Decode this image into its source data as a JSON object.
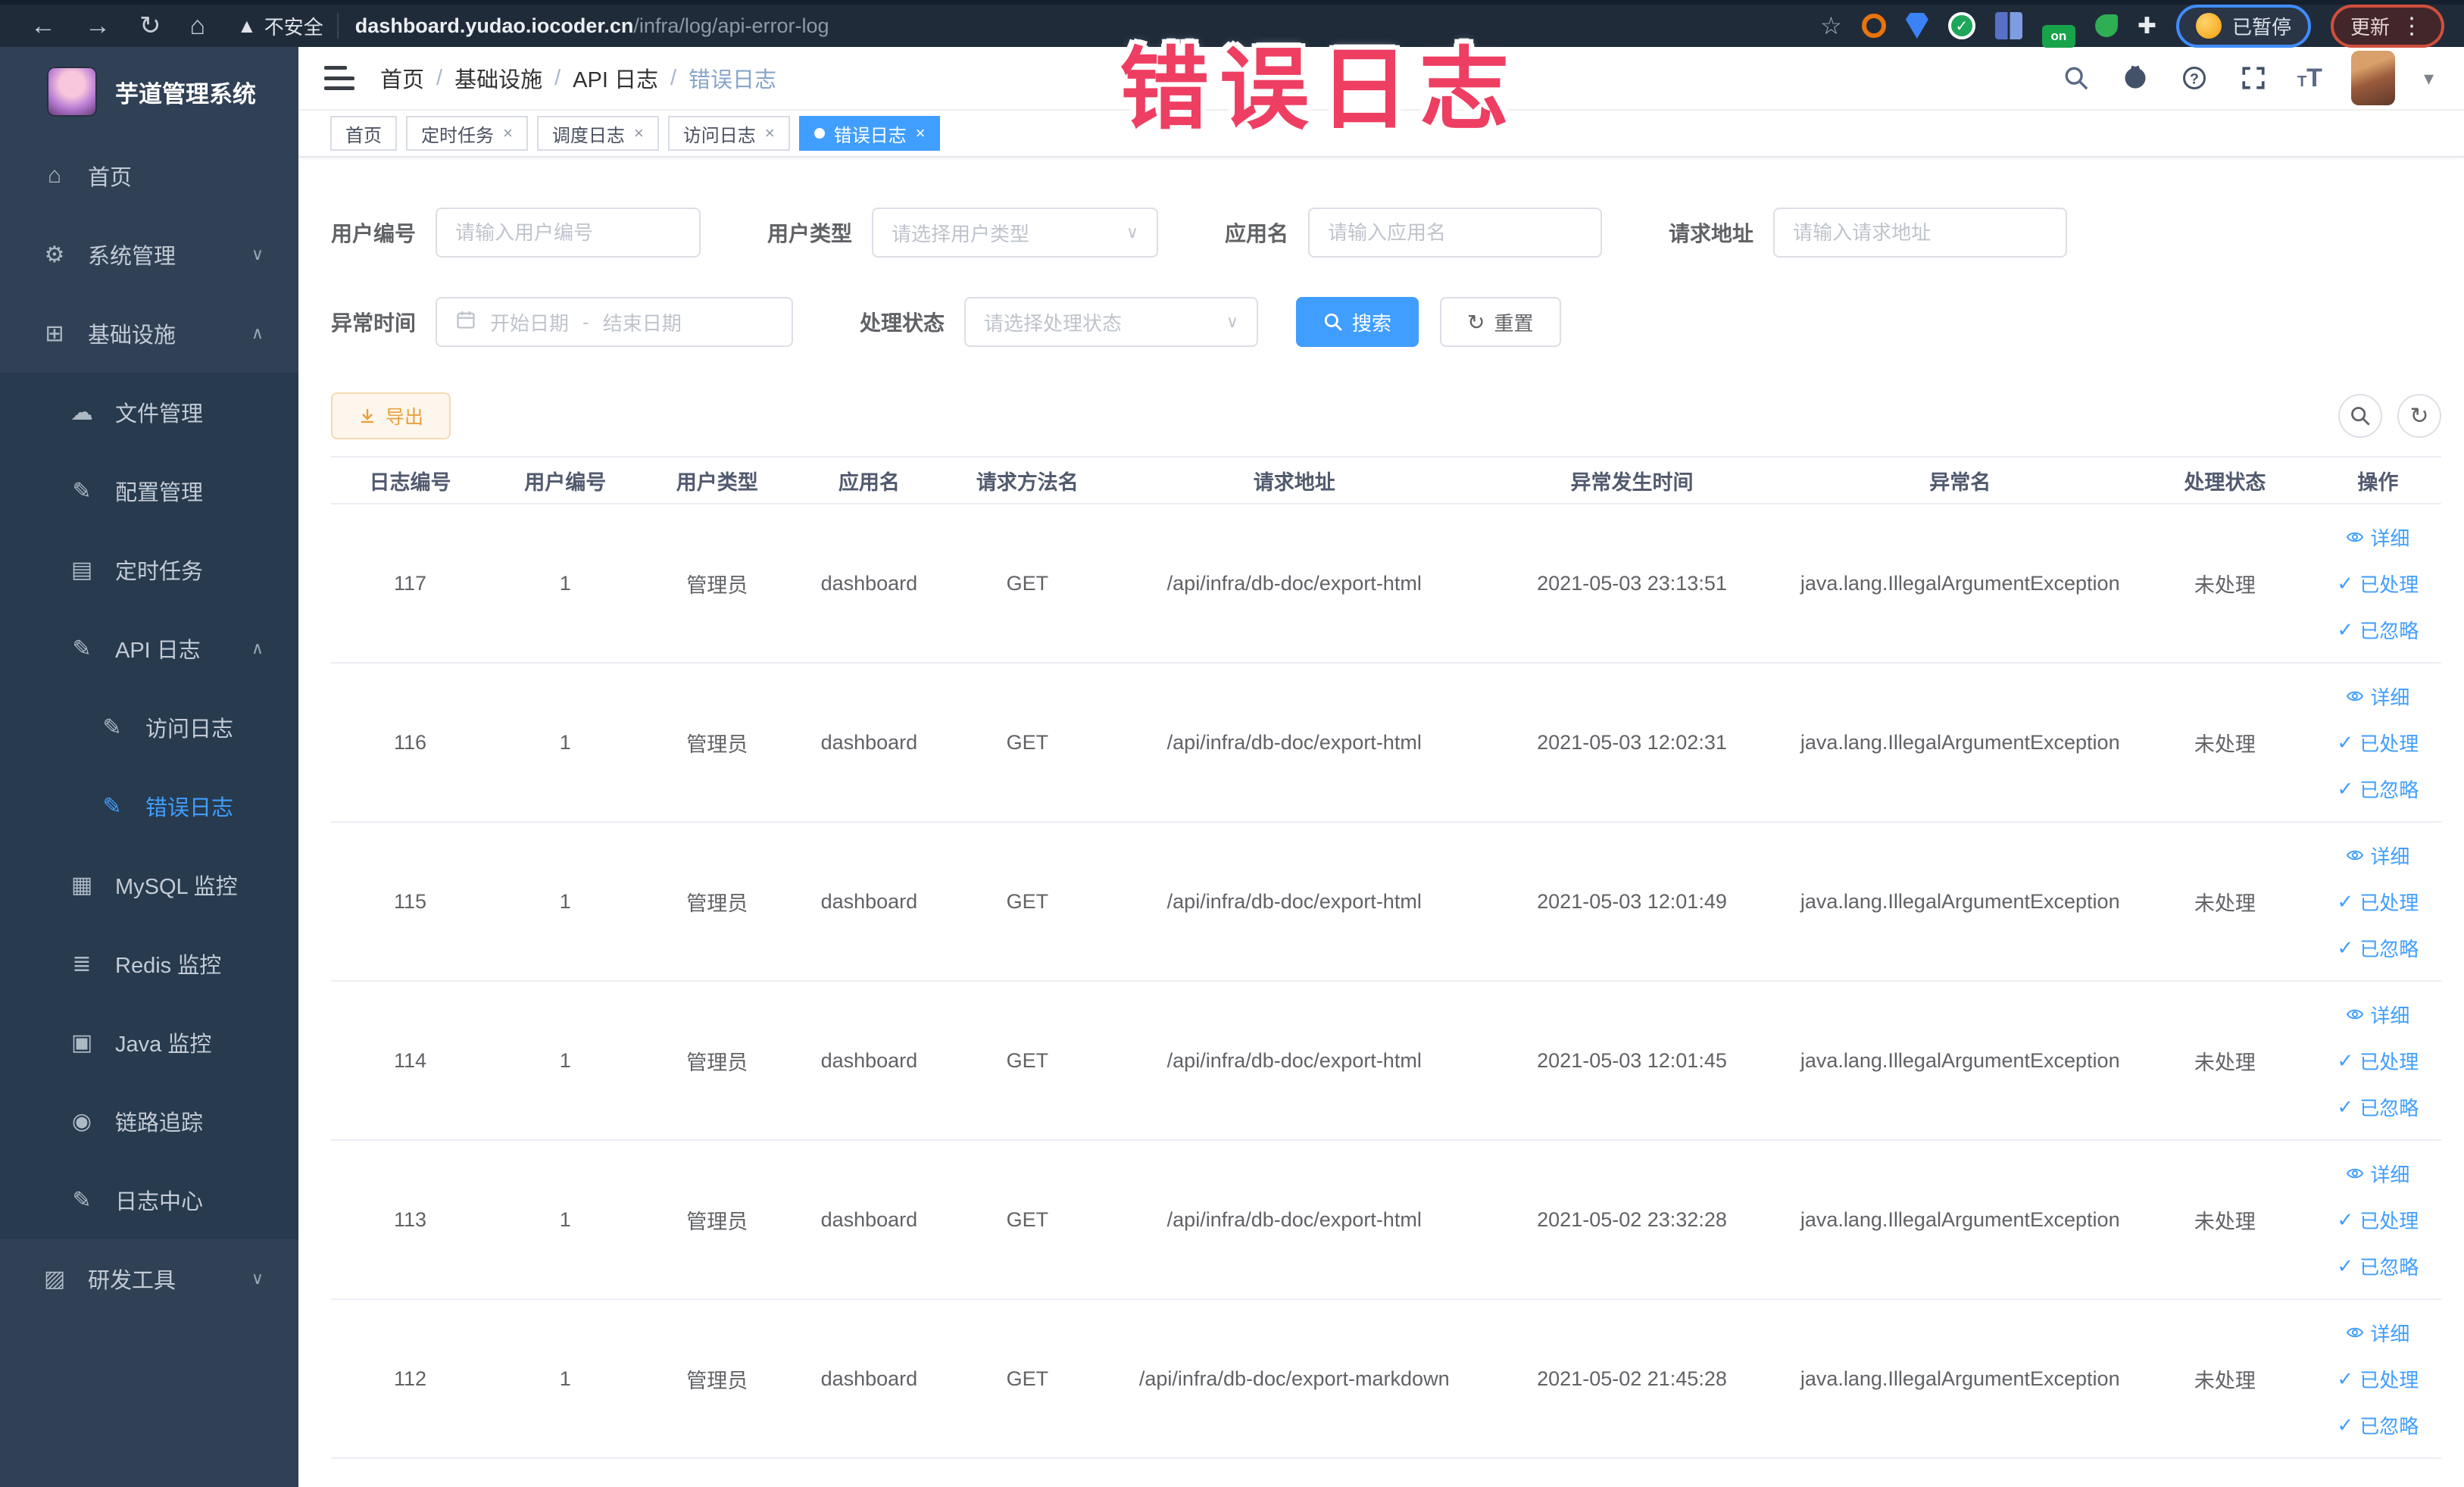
{
  "overlay_title": "错误日志",
  "browser": {
    "security_label": "不安全",
    "url_host": "dashboard.yudao.iocoder.cn",
    "url_path": "/infra/log/api-error-log",
    "on_badge": "on",
    "paused_badge": "已暂停",
    "update_button": "更新"
  },
  "sidebar": {
    "logo_title": "芋道管理系统",
    "items": [
      {
        "name": "home",
        "label": "首页",
        "icon": "home",
        "depth": 0,
        "chevron": "",
        "submenu": false,
        "active": false
      },
      {
        "name": "system-mgmt",
        "label": "系统管理",
        "icon": "gear",
        "depth": 0,
        "chevron": "down",
        "submenu": false,
        "active": false
      },
      {
        "name": "infrastructure",
        "label": "基础设施",
        "icon": "monitor",
        "depth": 0,
        "chevron": "up",
        "submenu": false,
        "active": false
      },
      {
        "name": "file-mgmt",
        "label": "文件管理",
        "icon": "cloud",
        "depth": 1,
        "chevron": "",
        "submenu": true,
        "active": false
      },
      {
        "name": "config-mgmt",
        "label": "配置管理",
        "icon": "edit",
        "depth": 1,
        "chevron": "",
        "submenu": true,
        "active": false
      },
      {
        "name": "scheduled-jobs",
        "label": "定时任务",
        "icon": "list",
        "depth": 1,
        "chevron": "",
        "submenu": true,
        "active": false
      },
      {
        "name": "api-log",
        "label": "API 日志",
        "icon": "edit",
        "depth": 1,
        "chevron": "up",
        "submenu": true,
        "active": false
      },
      {
        "name": "access-log",
        "label": "访问日志",
        "icon": "edit",
        "depth": 2,
        "chevron": "",
        "submenu": true,
        "active": false
      },
      {
        "name": "error-log",
        "label": "错误日志",
        "icon": "edit",
        "depth": 2,
        "chevron": "",
        "submenu": true,
        "active": true
      },
      {
        "name": "mysql-monitor",
        "label": "MySQL 监控",
        "icon": "grid",
        "depth": 1,
        "chevron": "",
        "submenu": true,
        "active": false
      },
      {
        "name": "redis-monitor",
        "label": "Redis 监控",
        "icon": "layers",
        "depth": 1,
        "chevron": "",
        "submenu": true,
        "active": false
      },
      {
        "name": "java-monitor",
        "label": "Java 监控",
        "icon": "screen",
        "depth": 1,
        "chevron": "",
        "submenu": true,
        "active": false
      },
      {
        "name": "trace",
        "label": "链路追踪",
        "icon": "eye",
        "depth": 1,
        "chevron": "",
        "submenu": true,
        "active": false
      },
      {
        "name": "log-center",
        "label": "日志中心",
        "icon": "edit",
        "depth": 1,
        "chevron": "",
        "submenu": true,
        "active": false
      },
      {
        "name": "dev-tools",
        "label": "研发工具",
        "icon": "briefcase",
        "depth": 0,
        "chevron": "down",
        "submenu": false,
        "active": false
      }
    ]
  },
  "breadcrumb": [
    "首页",
    "基础设施",
    "API 日志",
    "错误日志"
  ],
  "tabs": [
    {
      "name": "home",
      "label": "首页",
      "closable": false,
      "active": false
    },
    {
      "name": "scheduled-jobs",
      "label": "定时任务",
      "closable": true,
      "active": false
    },
    {
      "name": "schedule-log",
      "label": "调度日志",
      "closable": true,
      "active": false
    },
    {
      "name": "access-log",
      "label": "访问日志",
      "closable": true,
      "active": false
    },
    {
      "name": "error-log",
      "label": "错误日志",
      "closable": true,
      "active": true
    }
  ],
  "filters": {
    "user_id": {
      "label": "用户编号",
      "placeholder": "请输入用户编号"
    },
    "user_type": {
      "label": "用户类型",
      "placeholder": "请选择用户类型"
    },
    "app_name": {
      "label": "应用名",
      "placeholder": "请输入应用名"
    },
    "request_url": {
      "label": "请求地址",
      "placeholder": "请输入请求地址"
    },
    "exception_time": {
      "label": "异常时间",
      "start_placeholder": "开始日期",
      "separator": "-",
      "end_placeholder": "结束日期"
    },
    "process_status": {
      "label": "处理状态",
      "placeholder": "请选择处理状态"
    },
    "search_button": "搜索",
    "reset_button": "重置"
  },
  "toolbar": {
    "export_button": "导出"
  },
  "table": {
    "columns": [
      "日志编号",
      "用户编号",
      "用户类型",
      "应用名",
      "请求方法名",
      "请求地址",
      "异常发生时间",
      "异常名",
      "处理状态",
      "操作"
    ],
    "action_labels": [
      "详细",
      "已处理",
      "已忽略"
    ],
    "rows": [
      {
        "id": "117",
        "user_id": "1",
        "user_type": "管理员",
        "app": "dashboard",
        "method": "GET",
        "url": "/api/infra/db-doc/export-html",
        "time": "2021-05-03 23:13:51",
        "exception": "java.lang.IllegalArgumentException",
        "status": "未处理"
      },
      {
        "id": "116",
        "user_id": "1",
        "user_type": "管理员",
        "app": "dashboard",
        "method": "GET",
        "url": "/api/infra/db-doc/export-html",
        "time": "2021-05-03 12:02:31",
        "exception": "java.lang.IllegalArgumentException",
        "status": "未处理"
      },
      {
        "id": "115",
        "user_id": "1",
        "user_type": "管理员",
        "app": "dashboard",
        "method": "GET",
        "url": "/api/infra/db-doc/export-html",
        "time": "2021-05-03 12:01:49",
        "exception": "java.lang.IllegalArgumentException",
        "status": "未处理"
      },
      {
        "id": "114",
        "user_id": "1",
        "user_type": "管理员",
        "app": "dashboard",
        "method": "GET",
        "url": "/api/infra/db-doc/export-html",
        "time": "2021-05-03 12:01:45",
        "exception": "java.lang.IllegalArgumentException",
        "status": "未处理"
      },
      {
        "id": "113",
        "user_id": "1",
        "user_type": "管理员",
        "app": "dashboard",
        "method": "GET",
        "url": "/api/infra/db-doc/export-html",
        "time": "2021-05-02 23:32:28",
        "exception": "java.lang.IllegalArgumentException",
        "status": "未处理"
      },
      {
        "id": "112",
        "user_id": "1",
        "user_type": "管理员",
        "app": "dashboard",
        "method": "GET",
        "url": "/api/infra/db-doc/export-markdown",
        "time": "2021-05-02 21:45:28",
        "exception": "java.lang.IllegalArgumentException",
        "status": "未处理"
      }
    ]
  },
  "colors": {
    "accent": "#409eff",
    "warning_text": "#e6a23c",
    "warning_bg": "#fdf6ec",
    "warning_border": "#f5dab1",
    "sidebar_bg": "#304156",
    "sidebar_submenu_bg": "#273a4e",
    "chrome_bg": "#202b3a",
    "overlay_pink": "#ee3e62",
    "table_border": "#ebeef5"
  }
}
